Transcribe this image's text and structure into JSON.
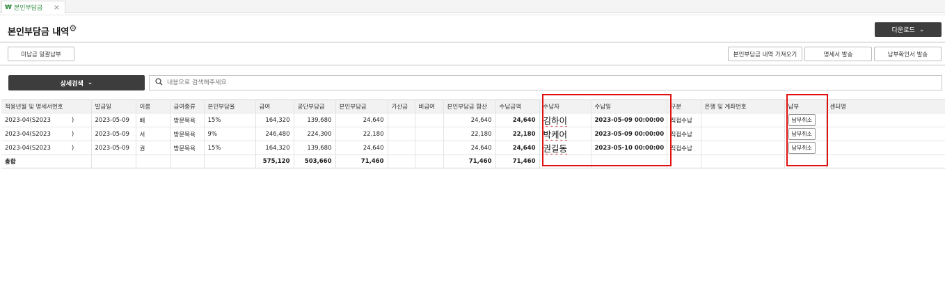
{
  "tab": {
    "label": "본인부담금",
    "close": "×",
    "won_glyph": "₩"
  },
  "page": {
    "title": "본인부담금 내역"
  },
  "toolbar": {
    "download_label": "다운로드",
    "batch_pay_label": "미납금 일괄납부",
    "import_label": "본인부담금 내역 가져오기",
    "statement_label": "명세서 발송",
    "confirm_label": "납부확인서 발송"
  },
  "search": {
    "detail_label": "상세검색",
    "placeholder": "내용으로 검색해주세요"
  },
  "table": {
    "headers": [
      "적용년월 및 명세서번호",
      "발급일",
      "이름",
      "급여종류",
      "본인부담율",
      "급여",
      "공단부담금",
      "본인부담금",
      "가산금",
      "비급여",
      "본인부담금 합산",
      "수납금액",
      "수납자",
      "수납일",
      "구분",
      "은행 및 계좌번호",
      "납부",
      "센터명"
    ],
    "rows": [
      {
        "month": "2023-04(S2023",
        "month_suffix": ")",
        "issued": "2023-05-09",
        "name": "배",
        "type": "방문목욕",
        "rate": "15%",
        "pay": "164,320",
        "public": "139,680",
        "own": "24,640",
        "extra": "",
        "nonpay": "",
        "own_sum": "24,640",
        "received": "24,640",
        "payer": "김하이",
        "paid_date": "2023-05-09 00:00:00",
        "category": "직접수납",
        "bank": "",
        "cancel": "납부취소",
        "center": ""
      },
      {
        "month": "2023-04(S2023",
        "month_suffix": ")",
        "issued": "2023-05-09",
        "name": "서",
        "type": "방문목욕",
        "rate": "9%",
        "pay": "246,480",
        "public": "224,300",
        "own": "22,180",
        "extra": "",
        "nonpay": "",
        "own_sum": "22,180",
        "received": "22,180",
        "payer": "박케어",
        "paid_date": "2023-05-09 00:00:00",
        "category": "직접수납",
        "bank": "",
        "cancel": "납부취소",
        "center": ""
      },
      {
        "month": "2023-04(S2023",
        "month_suffix": ")",
        "issued": "2023-05-09",
        "name": "권",
        "type": "방문목욕",
        "rate": "15%",
        "pay": "164,320",
        "public": "139,680",
        "own": "24,640",
        "extra": "",
        "nonpay": "",
        "own_sum": "24,640",
        "received": "24,640",
        "payer": "권길동",
        "paid_date": "2023-05-10 00:00:00",
        "category": "직접수납",
        "bank": "",
        "cancel": "납부취소",
        "center": ""
      }
    ],
    "total": {
      "label": "총합",
      "pay": "575,120",
      "public": "503,660",
      "own": "71,460",
      "own_sum": "71,460",
      "received": "71,460"
    }
  },
  "colors": {
    "dark_button": "#3d3d3d",
    "tab_green": "#2e8b3e",
    "highlight_red": "#e01010"
  }
}
